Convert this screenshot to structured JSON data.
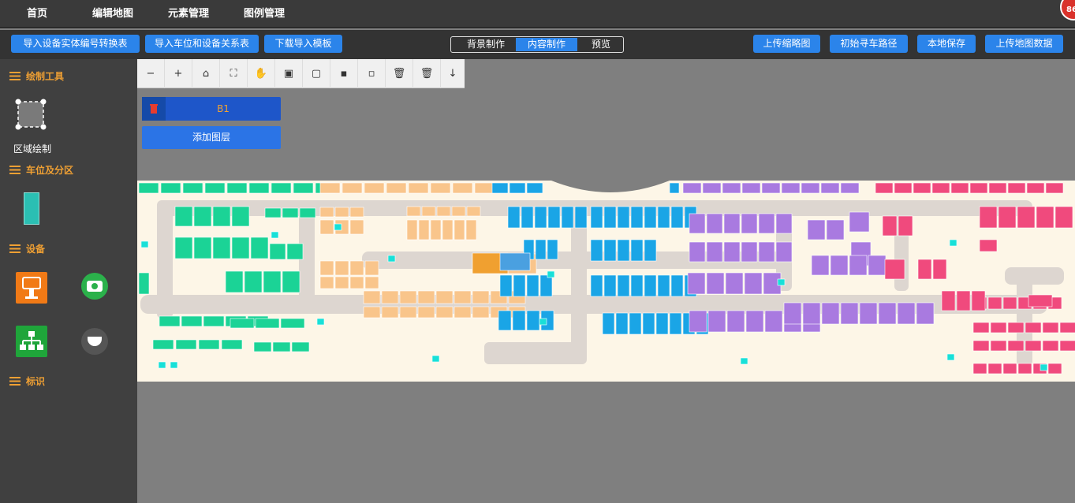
{
  "nav": {
    "items": [
      "首页",
      "编辑地图",
      "元素管理",
      "图例管理"
    ],
    "badge": "86"
  },
  "toolbar": {
    "left_buttons": [
      "导入设备实体编号转换表",
      "导入车位和设备关系表",
      "下载导入模板"
    ],
    "modes": [
      "背景制作",
      "内容制作",
      "预览"
    ],
    "active_mode": "内容制作",
    "right_buttons": [
      "上传缩略图",
      "初始寻车路径",
      "本地保存",
      "上传地图数据"
    ]
  },
  "sidebar": {
    "sections": {
      "draw_tools": "绘制工具",
      "parking": "车位及分区",
      "devices": "设备",
      "markers": "标识"
    },
    "region_draw_label": "区域绘制"
  },
  "map_tools": {
    "icons": [
      "zoom-out-icon",
      "zoom-in-icon",
      "home-icon",
      "fullscreen-icon",
      "hand-icon",
      "lock-icon",
      "unlock-icon",
      "lock-small-icon",
      "unlock-small-icon",
      "trash-icon",
      "trash-filled-icon",
      "arrow-down-icon"
    ]
  },
  "layers": {
    "current": "B1",
    "add_label": "添加图层"
  },
  "colors": {
    "accent": "#2b84ea",
    "section": "#f0a033",
    "zone_green": "#1bd396",
    "zone_orange": "#f9c58b",
    "zone_blue": "#1aa5e6",
    "zone_purple": "#a97ae0",
    "zone_pink": "#f04a7d",
    "device_cyan": "#18e0d8"
  }
}
